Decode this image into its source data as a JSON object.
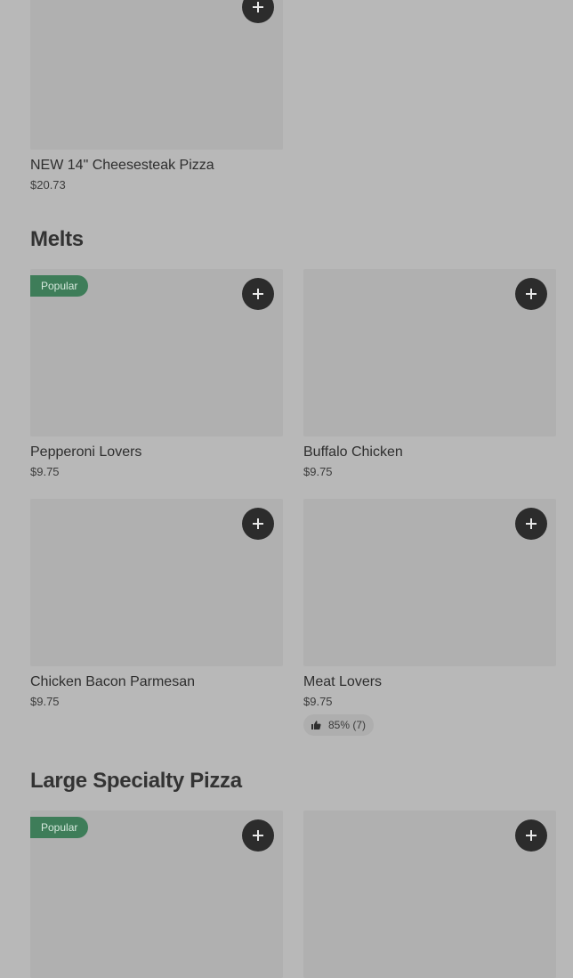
{
  "top_item": {
    "name": "NEW 14\" Cheesesteak Pizza",
    "price": "$20.73"
  },
  "sections": [
    {
      "title": "Melts",
      "items": [
        {
          "name": "Pepperoni Lovers",
          "price": "$9.75",
          "badge": "Popular"
        },
        {
          "name": "Buffalo Chicken",
          "price": "$9.75"
        },
        {
          "name": "Chicken Bacon Parmesan",
          "price": "$9.75"
        },
        {
          "name": "Meat Lovers",
          "price": "$9.75",
          "rating": "85% (7)"
        }
      ]
    },
    {
      "title": "Large Specialty Pizza",
      "items": [
        {
          "badge": "Popular"
        },
        {}
      ]
    }
  ],
  "icons": {
    "add": "plus-icon",
    "rating": "thumbs-up-icon"
  },
  "colors": {
    "badge": "#3e7d59",
    "add_button": "#2c2c2c",
    "background": "#b8b8b8"
  }
}
